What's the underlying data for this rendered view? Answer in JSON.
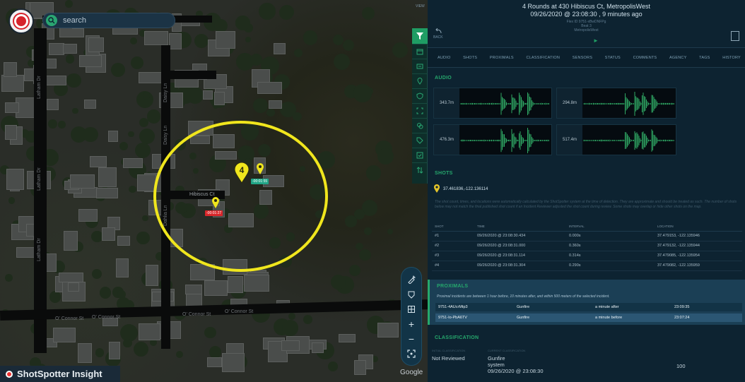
{
  "map": {
    "search": {
      "placeholder": "search"
    },
    "road_labels": {
      "lanham_dr_1": "Latham Dr",
      "lanham_dr_2": "Latham Dr",
      "lanham_dr_3": "Latham Dr",
      "daisy_ln_1": "Daisy Ln",
      "daisy_ln_2": "Daisy Ln",
      "dahlia_ln": "Dahlia Ln",
      "hibiscus_ct": "Hibiscus Ct",
      "oconnor_1": "O' Connor St",
      "oconnor_2": "O' Connor St",
      "oconnor_3": "O' Connor St",
      "oconnor_4": "O' Connor St"
    },
    "incident_count": "4",
    "tag_green": "-00:01:55",
    "tag_red": "-00:01:27",
    "brand": "ShotSpotter Insight",
    "google": "Google",
    "view_label": "VIEW"
  },
  "colors": {
    "ring": "#f0e61d",
    "accent_green": "#26a86d",
    "tag_red": "#d8262a",
    "tag_green": "#21a586",
    "panel_bg": "#0d2331"
  },
  "incident": {
    "title": "4 Rounds at 430 Hibiscus Ct, MetropolisWest",
    "subtitle": "09/26/2020 @ 23:08:30 , 9 minutes ago",
    "flex_id": "Flex ID 9751-xBwDNFPg",
    "beat": "Beat 3",
    "area": "MetropolisWest",
    "back_label": "BACK"
  },
  "tabs": [
    "AUDIO",
    "SHOTS",
    "PROXIMALS",
    "CLASSIFICATION",
    "SENSORS",
    "STATUS",
    "COMMENTS",
    "AGENCY",
    "TAGS",
    "HISTORY"
  ],
  "audio": {
    "heading": "AUDIO",
    "clips": [
      {
        "distance": "343.7m"
      },
      {
        "distance": "294.8m"
      },
      {
        "distance": "476.3m"
      },
      {
        "distance": "517.4m"
      }
    ]
  },
  "shots": {
    "heading": "SHOTS",
    "coords": "37.461836,-122.136114",
    "note": "The shot count, times, and locations were automatically calculated by the ShotSpotter system at the time of detection. They are approximate and should be treated as such. The number of shots below may not match the final published shot count if an Incident Reviewer adjusted the shot count during review. Some shots may overlap or hide other shots on the map.",
    "columns": [
      "SHOT",
      "TIME",
      "INTERVAL",
      "LOCATION"
    ],
    "rows": [
      {
        "shot": "#1",
        "time": "09/26/2020 @ 23:08:30.434",
        "interval": "0.000s",
        "location": "37.479153, -122.135946"
      },
      {
        "shot": "#2",
        "time": "09/26/2020 @ 23:08:31.000",
        "interval": "0.360s",
        "location": "37.479132, -122.135944"
      },
      {
        "shot": "#3",
        "time": "09/26/2020 @ 23:08:31.114",
        "interval": "0.314s",
        "location": "37.479085, -122.135954"
      },
      {
        "shot": "#4",
        "time": "09/26/2020 @ 23:08:31.304",
        "interval": "0.290s",
        "location": "37.479082, -122.135959"
      }
    ]
  },
  "proximals": {
    "heading": "PROXIMALS",
    "note": "Proximal incidents are between 1 hour before, 10 minutes after, and within 500 meters of the selected incident.",
    "rows": [
      {
        "id": "9751-4AUcrMtp3",
        "type": "Gunfire",
        "relative": "a minute after",
        "time": "23:09:35"
      },
      {
        "id": "9751-Io-PbA6TV",
        "type": "Gunfire",
        "relative": "a minute before",
        "time": "23:07:24"
      }
    ]
  },
  "classification": {
    "heading": "CLASSIFICATION",
    "initial_label": "INITIAL CLASSIFICATION",
    "current_label": "CURRENT CLASSIFICATION",
    "initial_value": "Not Reviewed",
    "current_value": "Gunfire",
    "current_by": "system",
    "current_time": "09/26/2020 @ 23:08:30",
    "score": "100"
  }
}
